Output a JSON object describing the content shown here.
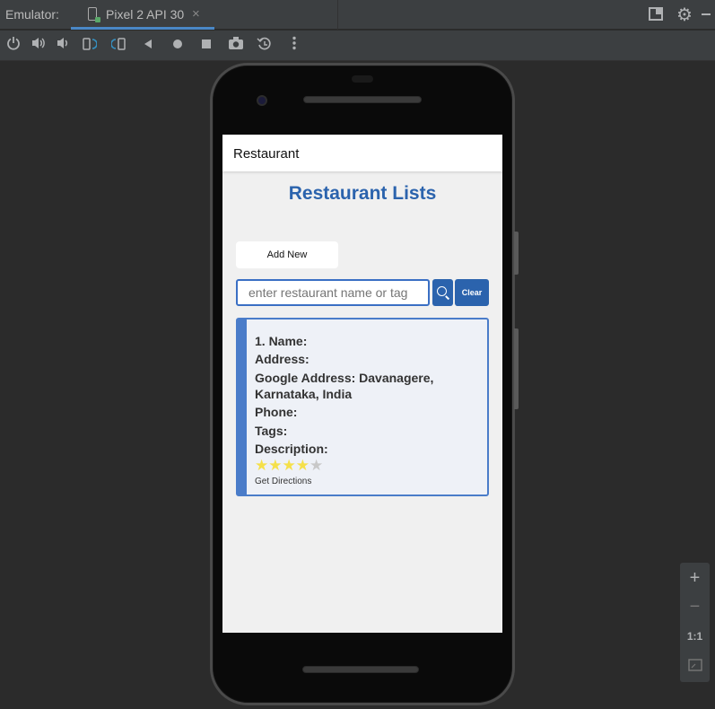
{
  "ide": {
    "window_label": "Emulator:",
    "device_tab": "Pixel 2 API 30",
    "close_glyph": "×",
    "settings_glyph": "⚙"
  },
  "toolbar": {
    "icons": [
      "power-icon",
      "volume-up-icon",
      "volume-down-icon",
      "rotate-left-icon",
      "rotate-right-icon",
      "back-icon",
      "home-icon",
      "overview-icon",
      "screenshot-icon",
      "snapshot-icon",
      "more-icon"
    ]
  },
  "zoom": {
    "plus": "+",
    "minus": "−",
    "actual_size": "1:1"
  },
  "app": {
    "appbar_title": "Restaurant",
    "heading": "Restaurant Lists",
    "add_button": "Add New",
    "search": {
      "placeholder": "enter restaurant name or tag",
      "clear_label": "Clear"
    },
    "restaurants": [
      {
        "title_line": "1. Name:",
        "address_line": "Address:",
        "google_address_line1": "Google Address: Davanagere,",
        "google_address_line2": "Karnataka, India",
        "phone_line": "Phone:",
        "tags_line": "Tags:",
        "description_line": "Description:",
        "rating": 4,
        "rating_max": 5,
        "directions_label": "Get Directions"
      }
    ]
  },
  "colors": {
    "accent": "#2b63ad",
    "card_border": "#4a7cc9",
    "star_on": "#f5e04a",
    "star_off": "#c8c8c8"
  }
}
